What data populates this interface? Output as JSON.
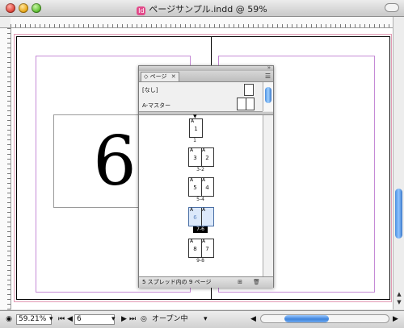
{
  "window": {
    "title": "ページサンプル.indd @ 59%",
    "doc_icon_label": "Id"
  },
  "canvas": {
    "page_number_text": "6"
  },
  "status_bar": {
    "zoom_value": "59.21%",
    "page_field_value": "6",
    "preflight_status": "オープン中",
    "nav_first": "⏮",
    "nav_prev": "◀",
    "nav_next": "▶",
    "nav_last": "⏭"
  },
  "pages_panel": {
    "tab_label": "ページ",
    "tab_index_glyph": "◇",
    "masters": [
      {
        "label": "[なし]"
      },
      {
        "label": "A-マスター"
      }
    ],
    "spreads": [
      {
        "label": "1",
        "pages": [
          "1"
        ]
      },
      {
        "label": "3-2",
        "pages": [
          "3",
          "2"
        ]
      },
      {
        "label": "5-4",
        "pages": [
          "5",
          "4"
        ]
      },
      {
        "label": "7-6",
        "pages": [
          "6",
          ""
        ],
        "selected": true
      },
      {
        "label": "9-8",
        "pages": [
          "8",
          "7"
        ]
      }
    ],
    "master_prefix": "A",
    "footer_text": "5 スプレッド内の 9 ページ"
  },
  "colors": {
    "margin_guide": "#c58ad6",
    "bleed_guide": "#e39ab4",
    "scroll_thumb": "#4b8fe0",
    "selected_page": "#dce9fb"
  }
}
